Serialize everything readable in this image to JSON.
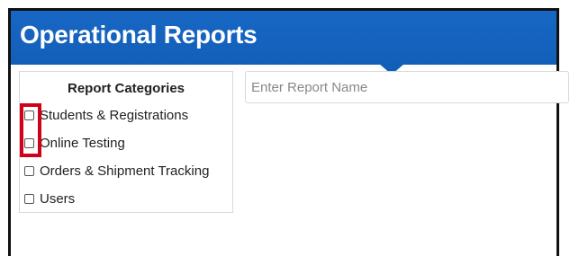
{
  "header": {
    "title": "Operational Reports"
  },
  "categories": {
    "title": "Report Categories",
    "items": [
      {
        "label": "Students & Registrations"
      },
      {
        "label": "Online Testing"
      },
      {
        "label": "Orders & Shipment Tracking"
      },
      {
        "label": "Users"
      }
    ]
  },
  "search": {
    "placeholder": "Enter Report Name",
    "value": ""
  },
  "colors": {
    "header": "#1565c0",
    "highlight": "#d0021b"
  }
}
